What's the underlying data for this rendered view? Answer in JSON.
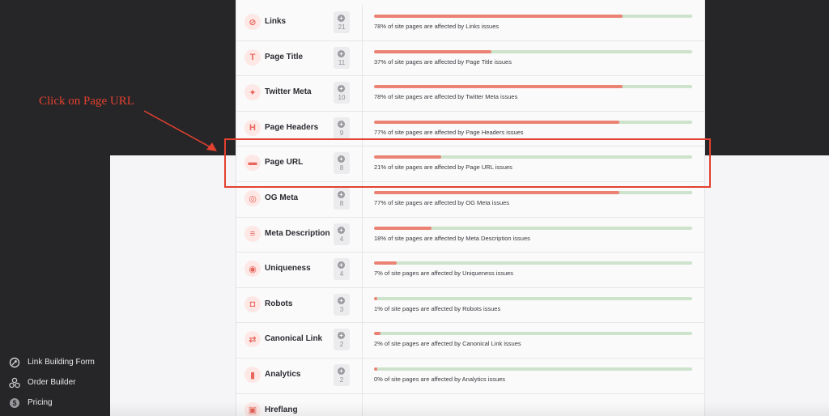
{
  "annotation": {
    "text": "Click on Page URL",
    "color": "#e3402f"
  },
  "colors": {
    "bar_fill": "#ec8274",
    "bar_track": "#cde3cc",
    "dark": "#262628"
  },
  "nav": [
    {
      "label": "Link Building Form",
      "icon": "link-building-icon"
    },
    {
      "label": "Order Builder",
      "icon": "order-builder-icon"
    },
    {
      "label": "Pricing",
      "icon": "dollar-icon"
    }
  ],
  "rows": [
    {
      "label": "Links",
      "icon": "link-icon",
      "glyph": "⊘",
      "count": "21",
      "percent": 78,
      "text": "78% of site pages are affected by Links issues"
    },
    {
      "label": "Page Title",
      "icon": "title-icon",
      "glyph": "T",
      "count": "11",
      "percent": 37,
      "text": "37% of site pages are affected by Page Title issues"
    },
    {
      "label": "Twitter Meta",
      "icon": "twitter-icon",
      "glyph": "✦",
      "count": "10",
      "percent": 78,
      "text": "78% of site pages are affected by Twitter Meta issues"
    },
    {
      "label": "Page Headers",
      "icon": "header-icon",
      "glyph": "H",
      "count": "9",
      "percent": 77,
      "text": "77% of site pages are affected by Page Headers issues"
    },
    {
      "label": "Page URL",
      "icon": "url-icon",
      "glyph": "▬",
      "count": "8",
      "percent": 21,
      "text": "21% of site pages are affected by Page URL issues"
    },
    {
      "label": "OG Meta",
      "icon": "og-meta-icon",
      "glyph": "◎",
      "count": "8",
      "percent": 77,
      "text": "77% of site pages are affected by OG Meta issues"
    },
    {
      "label": "Meta Description",
      "icon": "description-icon",
      "glyph": "≡",
      "count": "4",
      "percent": 18,
      "text": "18% of site pages are affected by Meta Description issues"
    },
    {
      "label": "Uniqueness",
      "icon": "fingerprint-icon",
      "glyph": "◉",
      "count": "4",
      "percent": 7,
      "text": "7% of site pages are affected by Uniqueness issues"
    },
    {
      "label": "Robots",
      "icon": "robot-icon",
      "glyph": "◘",
      "count": "3",
      "percent": 1,
      "text": "1% of site pages are affected by Robots issues"
    },
    {
      "label": "Canonical Link",
      "icon": "canonical-icon",
      "glyph": "⇄",
      "count": "2",
      "percent": 2,
      "text": "2% of site pages are affected by Canonical Link issues"
    },
    {
      "label": "Analytics",
      "icon": "analytics-icon",
      "glyph": "▮",
      "count": "2",
      "percent": 0,
      "text": "0% of site pages are affected by Analytics issues"
    },
    {
      "label": "Hreflang",
      "icon": "hreflang-icon",
      "glyph": "▣",
      "count": "",
      "percent": null,
      "text": ""
    }
  ]
}
